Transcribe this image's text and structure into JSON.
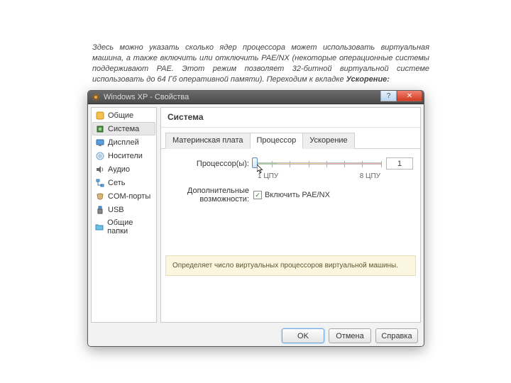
{
  "description": {
    "text_before": "Здесь можно указать сколько ядер процессора может использовать виртуальная машина, а также включить или отключить PAE/NX (некоторые операционные системы поддерживают PAE. Этот режим позволяет 32-битной виртуальной системе использовать до 64 Гб оперативной памяти). Переходим к вкладке ",
    "text_bold": "Ускорение:",
    "text_after": ""
  },
  "window": {
    "title": "Windows XP - Свойства",
    "sidebar": [
      {
        "label": "Общие",
        "icon": "general"
      },
      {
        "label": "Система",
        "icon": "system",
        "selected": true
      },
      {
        "label": "Дисплей",
        "icon": "display"
      },
      {
        "label": "Носители",
        "icon": "storage"
      },
      {
        "label": "Аудио",
        "icon": "audio"
      },
      {
        "label": "Сеть",
        "icon": "network"
      },
      {
        "label": "COM-порты",
        "icon": "serial"
      },
      {
        "label": "USB",
        "icon": "usb"
      },
      {
        "label": "Общие папки",
        "icon": "shared"
      }
    ],
    "panel_title": "Система",
    "tabs": {
      "motherboard": "Материнская плата",
      "processor": "Процессор",
      "accel": "Ускорение"
    },
    "processor": {
      "label": "Процессор(ы):",
      "value": "1",
      "min_label": "1 ЦПУ",
      "max_label": "8 ЦПУ"
    },
    "extras": {
      "label": "Дополнительные возможности:",
      "pae_label": "Включить PAE/NX",
      "pae_checked": true
    },
    "hint": "Определяет число виртуальных процессоров виртуальной машины.",
    "buttons": {
      "ok": "OK",
      "cancel": "Отмена",
      "help": "Справка"
    },
    "title_icons": {
      "help": "?",
      "close": "✕"
    }
  }
}
